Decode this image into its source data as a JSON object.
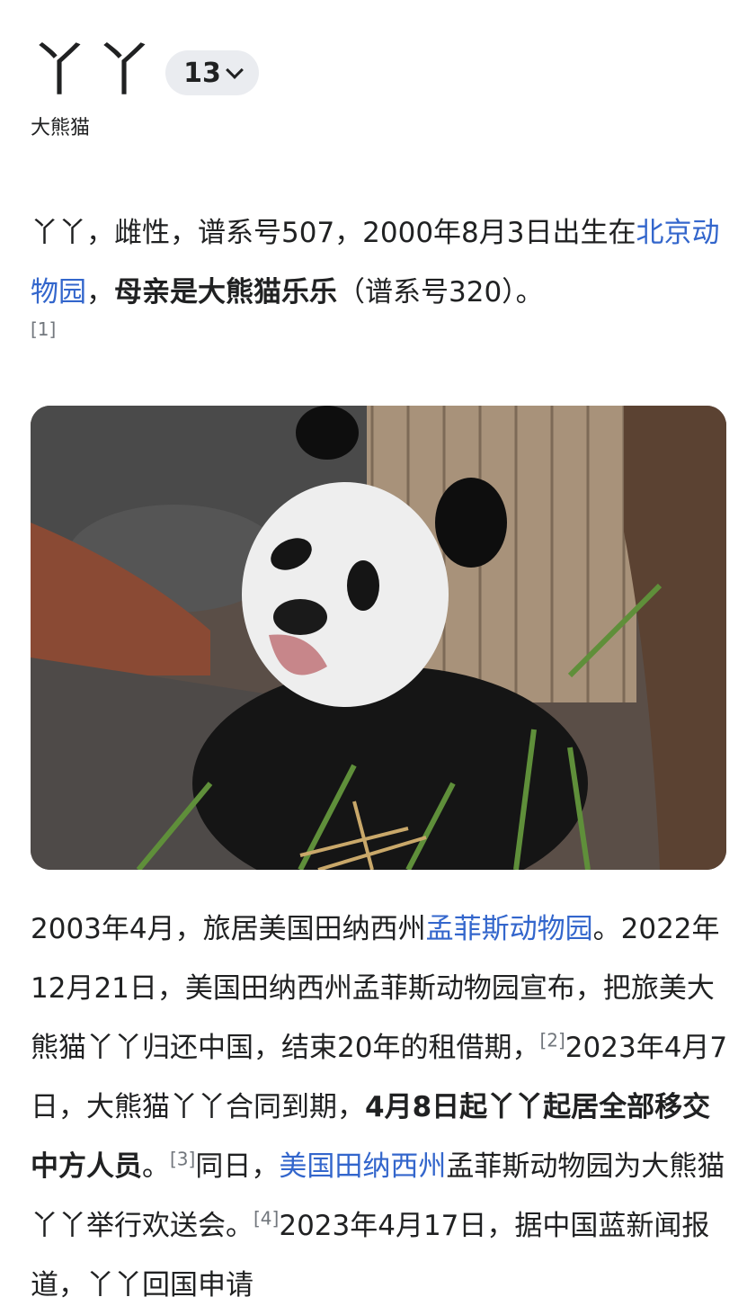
{
  "header": {
    "title": "丫丫",
    "language_count": "13",
    "subtitle": "大熊猫"
  },
  "intro": {
    "t1": "丫丫，雌性，谱系号507，2000年8月3日出生在",
    "link_zoo": "北京动物园",
    "t2": "，",
    "bold_mother": "母亲是大熊猫乐乐",
    "t3": "（谱系号320）。",
    "ref1": "[1]"
  },
  "image": {
    "subject": "panda-photo"
  },
  "history": {
    "t1": "2003年4月，旅居美国田纳西州",
    "link_memphis_zoo": "孟菲斯动物园",
    "t2": "。2022年12月21日，美国田纳西州孟菲斯动物园宣布，把旅美大熊猫丫丫归还中国，结束20年的租借期，",
    "ref2": "[2]",
    "t3": "2023年4月7日，大熊猫丫丫合同到期，",
    "bold_transfer": "4月8日起丫丫起居全部移交中方人员",
    "t4": "。",
    "ref3": "[3]",
    "t5": "同日，",
    "link_tennessee": "美国田纳西州",
    "t6": "孟菲斯动物园为大熊猫丫丫举行欢送会。",
    "ref4": "[4]",
    "t7": "2023年4月17日，据中国蓝新闻报道，丫丫回国申请"
  },
  "colors": {
    "link": "#3366cc",
    "text": "#202122",
    "ref": "#72777d",
    "badge_bg": "#eaecf0"
  }
}
